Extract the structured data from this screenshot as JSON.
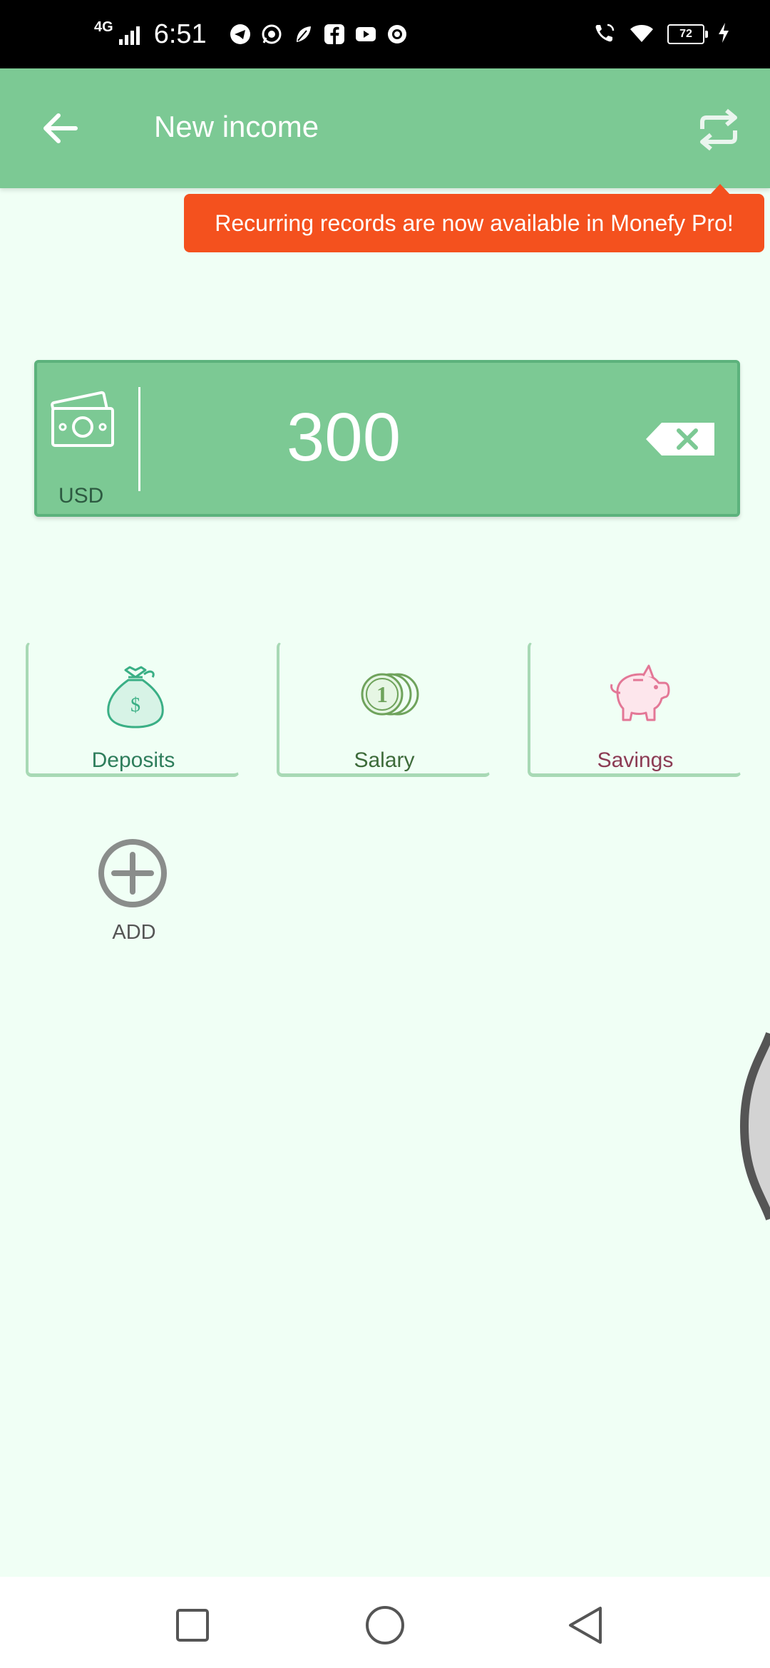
{
  "status_bar": {
    "network": "4G",
    "time": "6:51",
    "battery": "72",
    "app_icons": [
      "telegram-icon",
      "whatsapp-icon",
      "leaf-app-icon",
      "facebook-icon",
      "youtube-icon",
      "camera-app-icon"
    ]
  },
  "app_bar": {
    "title": "New income",
    "back_icon": "arrow-left-icon",
    "recurring_icon": "repeat-icon"
  },
  "tooltip": {
    "text": "Recurring records are now available in Monefy Pro!"
  },
  "amount_card": {
    "currency": "USD",
    "amount": "300",
    "clear_icon": "backspace-icon"
  },
  "categories": [
    {
      "label": "Deposits",
      "icon": "money-bag-icon",
      "color": "#2e7d5b"
    },
    {
      "label": "Salary",
      "icon": "coins-icon",
      "color": "#3d6b3a"
    },
    {
      "label": "Savings",
      "icon": "piggy-bank-icon",
      "color": "#8c3b54"
    }
  ],
  "add": {
    "label": "ADD",
    "icon": "plus-circle-icon"
  },
  "colors": {
    "app_bar": "#7cc994",
    "background": "#f0fff5",
    "tooltip": "#f4511e"
  }
}
